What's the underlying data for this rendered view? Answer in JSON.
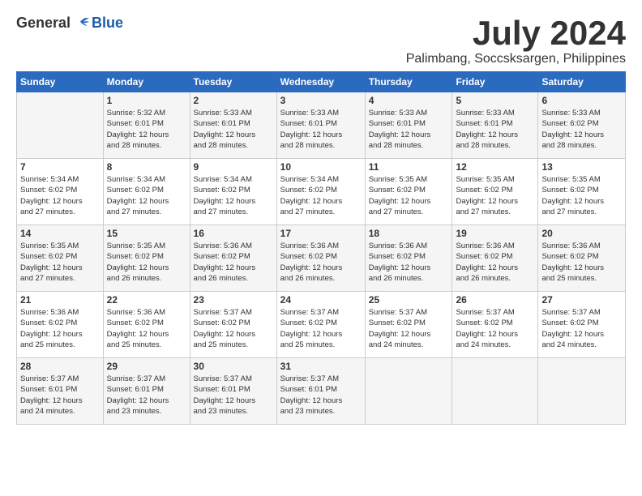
{
  "logo": {
    "general": "General",
    "blue": "Blue"
  },
  "title": {
    "month": "July 2024",
    "location": "Palimbang, Soccsksargen, Philippines"
  },
  "headers": [
    "Sunday",
    "Monday",
    "Tuesday",
    "Wednesday",
    "Thursday",
    "Friday",
    "Saturday"
  ],
  "weeks": [
    [
      {
        "day": "",
        "info": ""
      },
      {
        "day": "1",
        "info": "Sunrise: 5:32 AM\nSunset: 6:01 PM\nDaylight: 12 hours\nand 28 minutes."
      },
      {
        "day": "2",
        "info": "Sunrise: 5:33 AM\nSunset: 6:01 PM\nDaylight: 12 hours\nand 28 minutes."
      },
      {
        "day": "3",
        "info": "Sunrise: 5:33 AM\nSunset: 6:01 PM\nDaylight: 12 hours\nand 28 minutes."
      },
      {
        "day": "4",
        "info": "Sunrise: 5:33 AM\nSunset: 6:01 PM\nDaylight: 12 hours\nand 28 minutes."
      },
      {
        "day": "5",
        "info": "Sunrise: 5:33 AM\nSunset: 6:01 PM\nDaylight: 12 hours\nand 28 minutes."
      },
      {
        "day": "6",
        "info": "Sunrise: 5:33 AM\nSunset: 6:02 PM\nDaylight: 12 hours\nand 28 minutes."
      }
    ],
    [
      {
        "day": "7",
        "info": "Sunrise: 5:34 AM\nSunset: 6:02 PM\nDaylight: 12 hours\nand 27 minutes."
      },
      {
        "day": "8",
        "info": "Sunrise: 5:34 AM\nSunset: 6:02 PM\nDaylight: 12 hours\nand 27 minutes."
      },
      {
        "day": "9",
        "info": "Sunrise: 5:34 AM\nSunset: 6:02 PM\nDaylight: 12 hours\nand 27 minutes."
      },
      {
        "day": "10",
        "info": "Sunrise: 5:34 AM\nSunset: 6:02 PM\nDaylight: 12 hours\nand 27 minutes."
      },
      {
        "day": "11",
        "info": "Sunrise: 5:35 AM\nSunset: 6:02 PM\nDaylight: 12 hours\nand 27 minutes."
      },
      {
        "day": "12",
        "info": "Sunrise: 5:35 AM\nSunset: 6:02 PM\nDaylight: 12 hours\nand 27 minutes."
      },
      {
        "day": "13",
        "info": "Sunrise: 5:35 AM\nSunset: 6:02 PM\nDaylight: 12 hours\nand 27 minutes."
      }
    ],
    [
      {
        "day": "14",
        "info": "Sunrise: 5:35 AM\nSunset: 6:02 PM\nDaylight: 12 hours\nand 27 minutes."
      },
      {
        "day": "15",
        "info": "Sunrise: 5:35 AM\nSunset: 6:02 PM\nDaylight: 12 hours\nand 26 minutes."
      },
      {
        "day": "16",
        "info": "Sunrise: 5:36 AM\nSunset: 6:02 PM\nDaylight: 12 hours\nand 26 minutes."
      },
      {
        "day": "17",
        "info": "Sunrise: 5:36 AM\nSunset: 6:02 PM\nDaylight: 12 hours\nand 26 minutes."
      },
      {
        "day": "18",
        "info": "Sunrise: 5:36 AM\nSunset: 6:02 PM\nDaylight: 12 hours\nand 26 minutes."
      },
      {
        "day": "19",
        "info": "Sunrise: 5:36 AM\nSunset: 6:02 PM\nDaylight: 12 hours\nand 26 minutes."
      },
      {
        "day": "20",
        "info": "Sunrise: 5:36 AM\nSunset: 6:02 PM\nDaylight: 12 hours\nand 25 minutes."
      }
    ],
    [
      {
        "day": "21",
        "info": "Sunrise: 5:36 AM\nSunset: 6:02 PM\nDaylight: 12 hours\nand 25 minutes."
      },
      {
        "day": "22",
        "info": "Sunrise: 5:36 AM\nSunset: 6:02 PM\nDaylight: 12 hours\nand 25 minutes."
      },
      {
        "day": "23",
        "info": "Sunrise: 5:37 AM\nSunset: 6:02 PM\nDaylight: 12 hours\nand 25 minutes."
      },
      {
        "day": "24",
        "info": "Sunrise: 5:37 AM\nSunset: 6:02 PM\nDaylight: 12 hours\nand 25 minutes."
      },
      {
        "day": "25",
        "info": "Sunrise: 5:37 AM\nSunset: 6:02 PM\nDaylight: 12 hours\nand 24 minutes."
      },
      {
        "day": "26",
        "info": "Sunrise: 5:37 AM\nSunset: 6:02 PM\nDaylight: 12 hours\nand 24 minutes."
      },
      {
        "day": "27",
        "info": "Sunrise: 5:37 AM\nSunset: 6:02 PM\nDaylight: 12 hours\nand 24 minutes."
      }
    ],
    [
      {
        "day": "28",
        "info": "Sunrise: 5:37 AM\nSunset: 6:01 PM\nDaylight: 12 hours\nand 24 minutes."
      },
      {
        "day": "29",
        "info": "Sunrise: 5:37 AM\nSunset: 6:01 PM\nDaylight: 12 hours\nand 23 minutes."
      },
      {
        "day": "30",
        "info": "Sunrise: 5:37 AM\nSunset: 6:01 PM\nDaylight: 12 hours\nand 23 minutes."
      },
      {
        "day": "31",
        "info": "Sunrise: 5:37 AM\nSunset: 6:01 PM\nDaylight: 12 hours\nand 23 minutes."
      },
      {
        "day": "",
        "info": ""
      },
      {
        "day": "",
        "info": ""
      },
      {
        "day": "",
        "info": ""
      }
    ]
  ]
}
